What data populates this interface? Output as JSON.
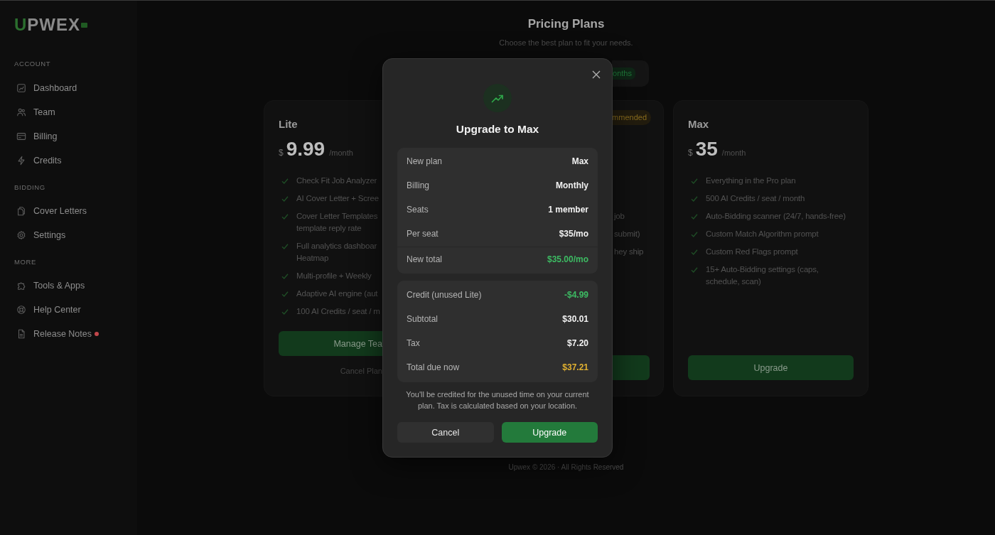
{
  "sidebar": {
    "logo": {
      "accent": "U",
      "rest": "PWEX"
    },
    "sections": [
      {
        "title": "ACCOUNT",
        "items": [
          {
            "label": "Dashboard",
            "new": false
          },
          {
            "label": "Team",
            "new": false
          },
          {
            "label": "Billing",
            "new": false
          },
          {
            "label": "Credits",
            "new": false
          }
        ]
      },
      {
        "title": "BIDDING",
        "items": [
          {
            "label": "Cover Letters",
            "new": false
          },
          {
            "label": "Settings",
            "new": false
          }
        ]
      },
      {
        "title": "MORE",
        "items": [
          {
            "label": "Tools & Apps",
            "new": false
          },
          {
            "label": "Help Center",
            "new": false
          },
          {
            "label": "Release Notes",
            "new": true
          }
        ]
      }
    ]
  },
  "main": {
    "title": "Pricing Plans",
    "subtitle": "Choose the best plan to fit your needs.",
    "billing_toggle": {
      "options": [
        {
          "label": "onths",
          "selected": true
        }
      ]
    },
    "plans": [
      {
        "kind": "clipped_right",
        "name": "Lite",
        "currency": "$",
        "price": "9.99",
        "period": "/month",
        "features": [
          {
            "lines": [
              "Check Fit Job Analyzer"
            ]
          },
          {
            "lines": [
              "AI Cover Letter + Scree"
            ]
          },
          {
            "lines": [
              "Cover Letter Templates",
              "template reply rate"
            ]
          },
          {
            "lines": [
              "Full analytics dashboar",
              "Heatmap"
            ]
          },
          {
            "lines": [
              "Multi-profile + Weekly"
            ]
          },
          {
            "lines": [
              "Adaptive AI engine (aut"
            ]
          },
          {
            "lines": [
              "100 AI Credits / seat / m"
            ]
          }
        ],
        "button": "Manage Tea",
        "link": "Cancel Plan"
      },
      {
        "kind": "clipped_left",
        "badge": "mmended",
        "features": [
          {
            "lines": [
              "job"
            ]
          },
          {
            "lines": [
              "submit)"
            ]
          },
          {
            "lines": [
              "hey ship"
            ]
          }
        ]
      },
      {
        "kind": "full",
        "name": "Max",
        "currency": "$",
        "price": "35",
        "period": "/month",
        "features": [
          {
            "lines": [
              "Everything in the Pro plan"
            ]
          },
          {
            "lines": [
              "500 AI Credits / seat / month"
            ]
          },
          {
            "lines": [
              "Auto-Bidding scanner (24/7, hands-free)"
            ]
          },
          {
            "lines": [
              "Custom Match Algorithm prompt"
            ]
          },
          {
            "lines": [
              "Custom Red Flags prompt"
            ]
          },
          {
            "lines": [
              "15+ Auto-Bidding settings (caps, schedule, scan)"
            ]
          }
        ],
        "button": "Upgrade"
      }
    ],
    "footer": "Upwex © 2026 · All Rights Reserved"
  },
  "modal": {
    "title": "Upgrade to Max",
    "summary": [
      {
        "kind": "line",
        "label": "New plan",
        "value": "Max",
        "color": "#f2f2f2"
      },
      {
        "kind": "line",
        "label": "Billing",
        "value": "Monthly",
        "color": "#f2f2f2"
      },
      {
        "kind": "line",
        "label": "Seats",
        "value": "1 member",
        "color": "#f2f2f2"
      },
      {
        "kind": "line",
        "label": "Per seat",
        "value": "$35/mo",
        "color": "#f2f2f2"
      },
      {
        "kind": "total",
        "label": "New total",
        "value": "$35.00/mo",
        "color": "#3dbb63"
      }
    ],
    "charges": [
      {
        "label": "Credit (unused Lite)",
        "value": "-$4.99",
        "color": "#3dbb63"
      },
      {
        "label": "Subtotal",
        "value": "$30.01",
        "color": "#f2f2f2"
      },
      {
        "label": "Tax",
        "value": "$7.20",
        "color": "#f2f2f2"
      },
      {
        "label": "Total due now",
        "value": "$37.21",
        "color": "#e0b030"
      }
    ],
    "note": "You'll be credited for the unused time on your current plan. Tax is calculated based on your location.",
    "buttons": [
      {
        "kind": "secondary",
        "label": "Cancel"
      },
      {
        "kind": "primary",
        "label": "Upgrade"
      }
    ]
  }
}
